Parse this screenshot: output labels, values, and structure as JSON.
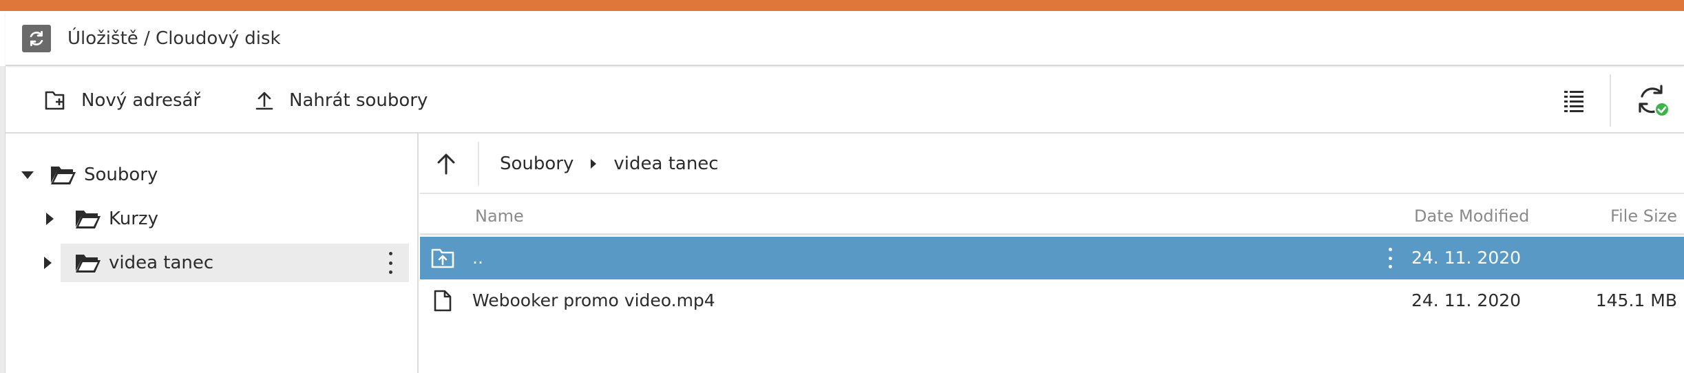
{
  "header": {
    "breadcrumb_title": "Úložiště / Cloudový disk",
    "accent_color": "#e0773a"
  },
  "toolbar": {
    "new_folder_label": "Nový adresář",
    "upload_label": "Nahrát soubory"
  },
  "tree": {
    "root_label": "Soubory",
    "children": [
      {
        "label": "Kurzy"
      },
      {
        "label": "videa tanec"
      }
    ]
  },
  "breadcrumbs": {
    "items": [
      "Soubory",
      "videa tanec"
    ]
  },
  "file_list": {
    "columns": {
      "name": "Name",
      "date_modified": "Date Modified",
      "file_size": "File Size"
    },
    "rows": [
      {
        "name": "..",
        "date": "24. 11. 2020",
        "size": "",
        "icon": "folder-up-icon",
        "selected": true
      },
      {
        "name": "Webooker promo video.mp4",
        "date": "24. 11. 2020",
        "size": "145.1 MB",
        "icon": "file-icon",
        "selected": false
      }
    ],
    "selection_color": "#5899c6"
  }
}
